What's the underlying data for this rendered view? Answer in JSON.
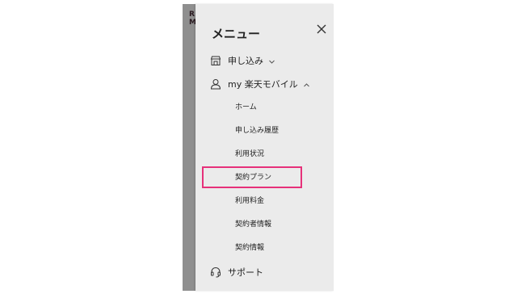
{
  "background": {
    "text_line1": "R",
    "text_line2": "M"
  },
  "menu": {
    "title": "メニュー",
    "items": [
      {
        "label": "申し込み",
        "icon": "store-icon",
        "expanded": false
      },
      {
        "label": "my 楽天モバイル",
        "icon": "person-icon",
        "expanded": true
      },
      {
        "label": "サポート",
        "icon": "headset-icon"
      }
    ],
    "sub_items": [
      "ホーム",
      "申し込み履歴",
      "利用状況",
      "契約プラン",
      "利用料金",
      "契約者情報",
      "契約情報"
    ],
    "highlight_color": "#e6317a"
  }
}
